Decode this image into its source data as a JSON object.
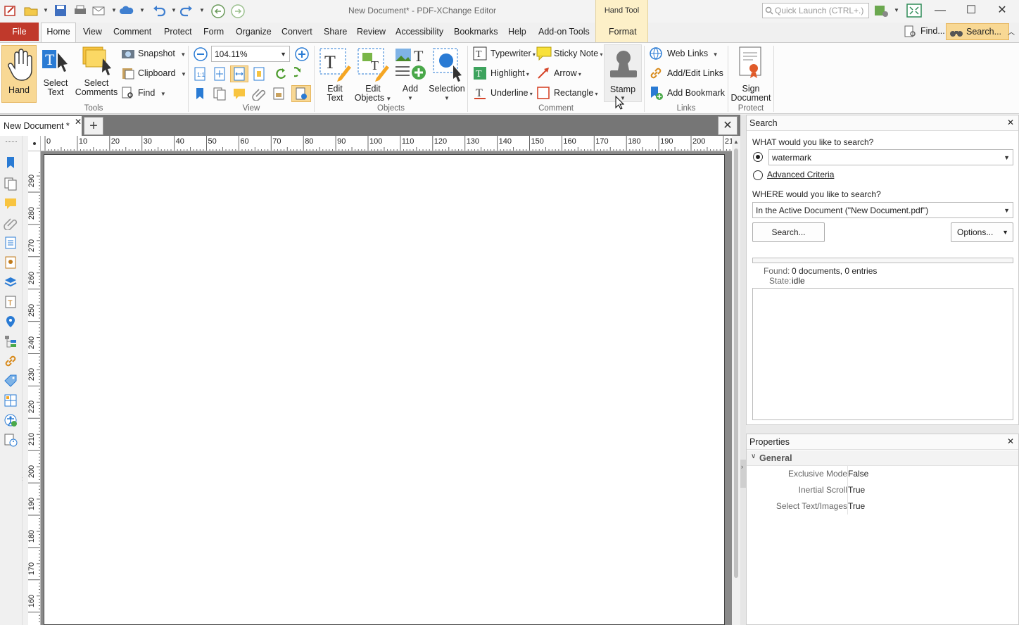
{
  "window": {
    "title": "New Document* - PDF-XChange Editor",
    "quick_launch_placeholder": "Quick Launch (CTRL+.)"
  },
  "context_tab": {
    "group_label": "Hand Tool",
    "tab_label": "Format"
  },
  "menu": {
    "file": "File",
    "tabs": [
      "Home",
      "View",
      "Comment",
      "Protect",
      "Form",
      "Organize",
      "Convert",
      "Share",
      "Review",
      "Accessibility",
      "Bookmarks",
      "Help",
      "Add-on Tools"
    ],
    "find": "Find...",
    "search": "Search..."
  },
  "ribbon": {
    "tools": {
      "label": "Tools",
      "hand": "Hand",
      "select_text": [
        "Select",
        "Text"
      ],
      "select_comments": [
        "Select",
        "Comments"
      ],
      "snapshot": "Snapshot",
      "clipboard": "Clipboard",
      "find": "Find"
    },
    "view": {
      "label": "View",
      "zoom_value": "104.11%"
    },
    "objects": {
      "label": "Objects",
      "edit_text": [
        "Edit",
        "Text"
      ],
      "edit_objects": [
        "Edit",
        "Objects"
      ],
      "add": "Add",
      "selection": "Selection"
    },
    "comment": {
      "label": "Comment",
      "typewriter": "Typewriter",
      "sticky_note": "Sticky Note",
      "highlight": "Highlight",
      "arrow": "Arrow",
      "underline": "Underline",
      "rectangle": "Rectangle",
      "stamp": "Stamp"
    },
    "links": {
      "label": "Links",
      "web_links": "Web Links",
      "add_edit_links": "Add/Edit Links",
      "add_bookmark": "Add Bookmark"
    },
    "protect": {
      "label": "Protect",
      "sign_document": [
        "Sign",
        "Document"
      ]
    }
  },
  "document": {
    "tab_label": "New Document *",
    "ruler_h": [
      "0",
      "10",
      "20",
      "30",
      "40",
      "50",
      "60",
      "70",
      "80",
      "90",
      "100",
      "110",
      "120",
      "130",
      "140",
      "150",
      "160",
      "170",
      "180",
      "190",
      "200",
      "21"
    ],
    "ruler_v": [
      "290",
      "280",
      "270",
      "260",
      "250",
      "240",
      "230",
      "220",
      "210",
      "200",
      "190",
      "180",
      "170",
      "160"
    ]
  },
  "search_panel": {
    "title": "Search",
    "what_label": "WHAT would you like to search?",
    "query": "watermark",
    "advanced_criteria": "Advanced Criteria",
    "where_label": "WHERE would you like to search?",
    "where_value": "In the Active Document (\"New Document.pdf\")",
    "search_button": "Search...",
    "options_button": "Options...",
    "found_key": "Found:",
    "found_value": "0 documents, 0 entries",
    "state_key": "State:",
    "state_value": "idle"
  },
  "properties_panel": {
    "title": "Properties",
    "section": "General",
    "rows": [
      {
        "key": "Exclusive Mode",
        "value": "False"
      },
      {
        "key": "Inertial Scroll",
        "value": "True"
      },
      {
        "key": "Select Text/Images",
        "value": "True"
      }
    ]
  },
  "colors": {
    "file_tab": "#c0392b",
    "active_tool": "#f8d894",
    "context_group": "#fdf0c8",
    "accent_blue": "#2a7bd4"
  }
}
